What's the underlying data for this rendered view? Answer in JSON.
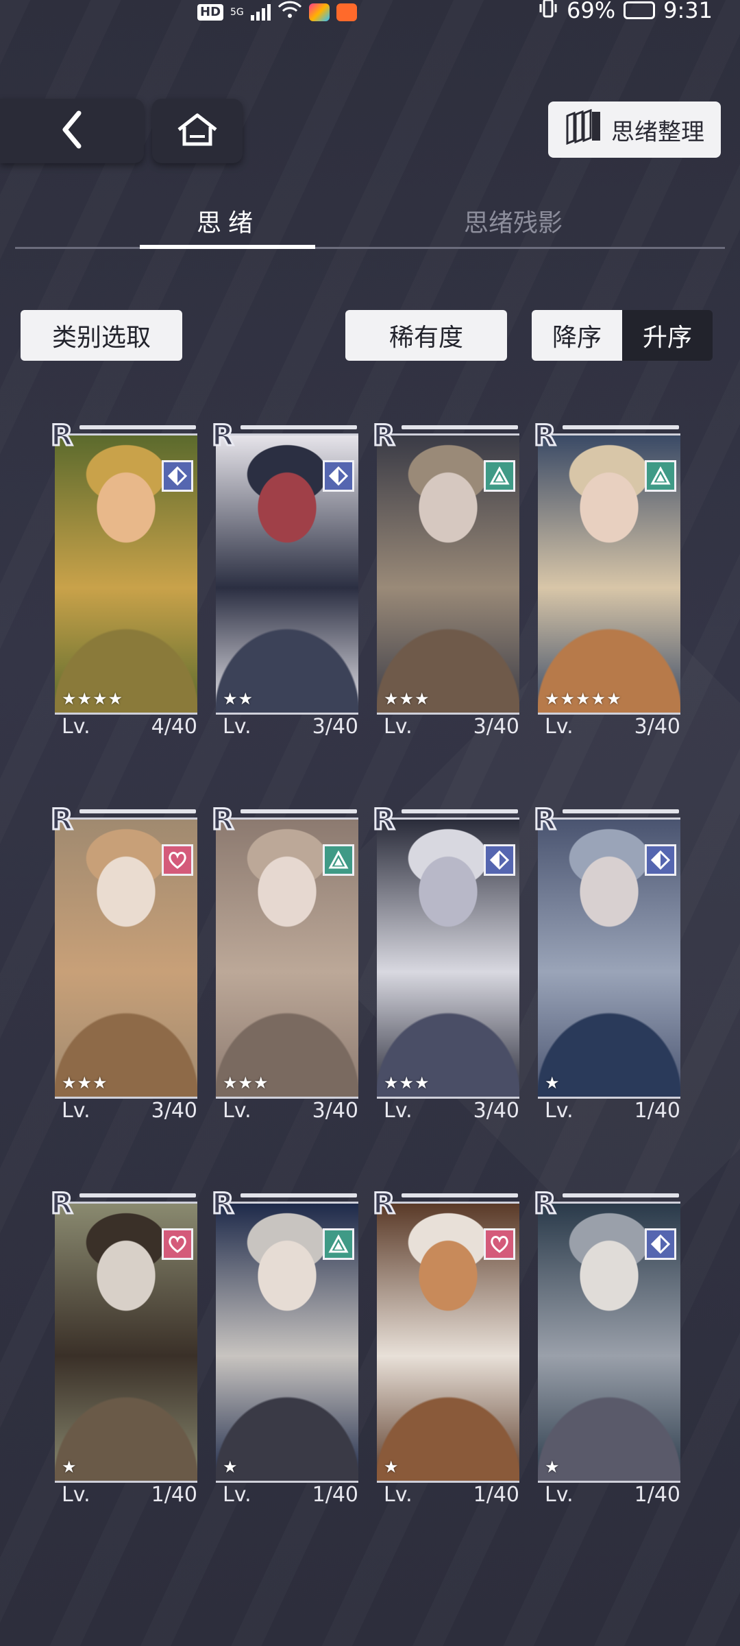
{
  "status_bar": {
    "hd": "HD",
    "network": "5G",
    "battery": "69%",
    "time": "9:31"
  },
  "nav": {
    "back_icon": "chevron-left-icon",
    "home_icon": "home-icon",
    "organize_label": "思绪整理",
    "organize_icon": "cards-stack-icon"
  },
  "tabs": {
    "active": "思绪",
    "inactive": "思绪残影"
  },
  "filters": {
    "category": "类别选取",
    "rarity": "稀有度",
    "desc": "降序",
    "asc": "升序"
  },
  "colors": {
    "diamond_type": "#5566b0",
    "triangle_type": "#3f9a86",
    "heart_type": "#d45a7a"
  },
  "cards": [
    {
      "rarity": "R",
      "type": "diamond-icon",
      "stars": "★★★★",
      "lv": "Lv.",
      "level": "4/40"
    },
    {
      "rarity": "R",
      "type": "diamond-icon",
      "stars": "★★",
      "lv": "Lv.",
      "level": "3/40"
    },
    {
      "rarity": "R",
      "type": "triangle-icon",
      "stars": "★★★",
      "lv": "Lv.",
      "level": "3/40"
    },
    {
      "rarity": "R",
      "type": "triangle-icon",
      "stars": "★★★★★",
      "lv": "Lv.",
      "level": "3/40"
    },
    {
      "rarity": "R",
      "type": "heart-icon",
      "stars": "★★★",
      "lv": "Lv.",
      "level": "3/40"
    },
    {
      "rarity": "R",
      "type": "triangle-icon",
      "stars": "★★★",
      "lv": "Lv.",
      "level": "3/40"
    },
    {
      "rarity": "R",
      "type": "diamond-icon",
      "stars": "★★★",
      "lv": "Lv.",
      "level": "3/40"
    },
    {
      "rarity": "R",
      "type": "diamond-icon",
      "stars": "★",
      "lv": "Lv.",
      "level": "1/40"
    },
    {
      "rarity": "R",
      "type": "heart-icon",
      "stars": "★",
      "lv": "Lv.",
      "level": "1/40"
    },
    {
      "rarity": "R",
      "type": "triangle-icon",
      "stars": "★",
      "lv": "Lv.",
      "level": "1/40"
    },
    {
      "rarity": "R",
      "type": "heart-icon",
      "stars": "★",
      "lv": "Lv.",
      "level": "1/40"
    },
    {
      "rarity": "R",
      "type": "diamond-icon",
      "stars": "★",
      "lv": "Lv.",
      "level": "1/40"
    }
  ]
}
